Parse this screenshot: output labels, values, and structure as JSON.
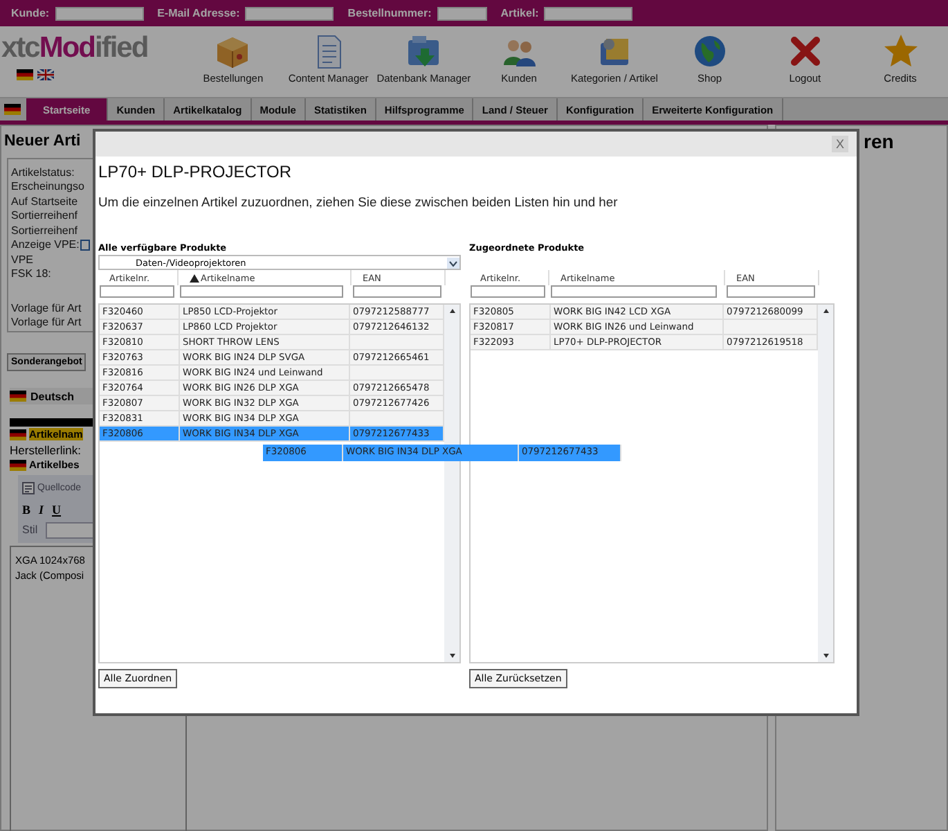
{
  "search_bar": {
    "fields": [
      {
        "label": "Kunde:"
      },
      {
        "label": "E-Mail Adresse:"
      },
      {
        "label": "Bestellnummer:"
      },
      {
        "label": "Artikel:"
      }
    ]
  },
  "logo": {
    "parts": [
      "xtc",
      "Mod",
      "ified"
    ]
  },
  "toolbar": [
    {
      "label": "Bestellungen"
    },
    {
      "label": "Content Manager"
    },
    {
      "label": "Datenbank Manager"
    },
    {
      "label": "Kunden"
    },
    {
      "label": "Kategorien / Artikel"
    },
    {
      "label": "Shop"
    },
    {
      "label": "Logout"
    },
    {
      "label": "Credits"
    }
  ],
  "nav_tabs": [
    {
      "label": "Startseite",
      "selected": true
    },
    {
      "label": "Kunden",
      "selected": false
    },
    {
      "label": "Artikelkatalog",
      "selected": false
    },
    {
      "label": "Module",
      "selected": false
    },
    {
      "label": "Statistiken",
      "selected": false
    },
    {
      "label": "Hilfsprogramme",
      "selected": false
    },
    {
      "label": "Land / Steuer",
      "selected": false
    },
    {
      "label": "Konfiguration",
      "selected": false
    },
    {
      "label": "Erweiterte Konfiguration",
      "selected": false
    }
  ],
  "page": {
    "heading": "Neuer Arti",
    "fields": [
      {
        "label": "Artikelstatus:",
        "kind": "text"
      },
      {
        "label": "Erscheinungso",
        "kind": "text"
      },
      {
        "label": "Auf Startseite",
        "kind": "text"
      },
      {
        "label": "Sortierreihenf",
        "kind": "text"
      },
      {
        "label": "Sortierreihenf",
        "kind": "text"
      },
      {
        "label": "Anzeige VPE:",
        "kind": "checkbox",
        "checked": false
      },
      {
        "label": "VPE",
        "kind": "text"
      },
      {
        "label": "FSK 18:",
        "kind": "text"
      }
    ],
    "templates": [
      "Vorlage für Art",
      "Vorlage für Art"
    ],
    "special_offer_button": "Sonderangebot",
    "language_tab": "Deutsch",
    "product_name_label": "Artikelnam",
    "manufacturer_link_label": "Herstellerlink:",
    "description_label": "Artikelbes",
    "editor": {
      "source_button": "Quellcode",
      "format_buttons": [
        "B",
        "I",
        "U"
      ],
      "style_label": "Stil",
      "content": [
        "XGA 1024x768",
        "Jack (Composi"
      ]
    }
  },
  "right_panel": {
    "heading": "ren"
  },
  "modal": {
    "close": "X",
    "heading": "LP70+ DLP-PROJECTOR",
    "instruction": "Um die einzelnen Artikel zuzuordnen, ziehen Sie diese zwischen beiden Listen hin und her",
    "lists": [
      {
        "title": "Alle verfügbare Produkte",
        "category": "Daten-/Videoprojektoren",
        "columns": [
          {
            "label": "Artikelnr.",
            "sorted": false
          },
          {
            "label": "Artikelname",
            "sorted": true
          },
          {
            "label": "EAN",
            "sorted": false
          }
        ],
        "rows": [
          {
            "number": "F320460",
            "name": "LP850 LCD-Projektor",
            "ean": "0797212588777",
            "selected": false
          },
          {
            "number": "F320637",
            "name": "LP860 LCD Projektor",
            "ean": "0797212646132",
            "selected": false
          },
          {
            "number": "F320810",
            "name": "SHORT THROW LENS",
            "ean": "",
            "selected": false
          },
          {
            "number": "F320763",
            "name": "WORK BIG IN24 DLP SVGA",
            "ean": "0797212665461",
            "selected": false
          },
          {
            "number": "F320816",
            "name": "WORK BIG IN24 und Leinwand",
            "ean": "",
            "selected": false
          },
          {
            "number": "F320764",
            "name": "WORK BIG IN26 DLP XGA",
            "ean": "0797212665478",
            "selected": false
          },
          {
            "number": "F320807",
            "name": "WORK BIG IN32 DLP XGA",
            "ean": "0797212677426",
            "selected": false
          },
          {
            "number": "F320831",
            "name": "WORK BIG IN34 DLP XGA",
            "ean": "",
            "selected": false
          },
          {
            "number": "F320806",
            "name": "WORK BIG IN34 DLP XGA",
            "ean": "0797212677433",
            "selected": true
          }
        ],
        "button": "Alle Zuordnen"
      },
      {
        "title": "Zugeordnete Produkte",
        "columns": [
          {
            "label": "Artikelnr.",
            "sorted": false
          },
          {
            "label": "Artikelname",
            "sorted": false
          },
          {
            "label": "EAN",
            "sorted": false
          }
        ],
        "rows": [
          {
            "number": "F320805",
            "name": "WORK BIG IN42 LCD XGA",
            "ean": "0797212680099",
            "selected": false
          },
          {
            "number": "F320817",
            "name": "WORK BIG IN26 und Leinwand",
            "ean": "",
            "selected": false
          },
          {
            "number": "F322093",
            "name": "LP70+ DLP-PROJECTOR",
            "ean": "0797212619518",
            "selected": false
          }
        ],
        "button": "Alle Zurücksetzen"
      }
    ],
    "drag_row": {
      "number": "F320806",
      "name": "WORK BIG IN34 DLP XGA",
      "ean": "0797212677433"
    }
  }
}
